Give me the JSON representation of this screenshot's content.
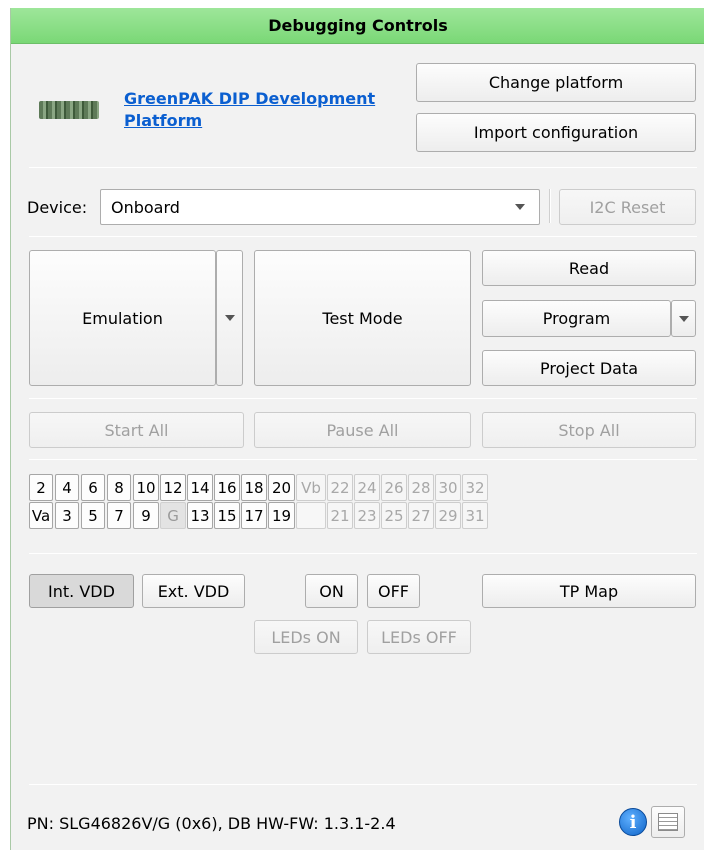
{
  "title": "Debugging Controls",
  "platform": {
    "name": "GreenPAK DIP Development Platform",
    "change_label": "Change platform",
    "import_label": "Import configuration"
  },
  "device": {
    "label": "Device:",
    "value": "Onboard",
    "i2c_reset_label": "I2C Reset"
  },
  "modes": {
    "emulation_label": "Emulation",
    "test_mode_label": "Test Mode",
    "read_label": "Read",
    "program_label": "Program",
    "project_data_label": "Project Data"
  },
  "controls": {
    "start_all": "Start All",
    "pause_all": "Pause All",
    "stop_all": "Stop All"
  },
  "pins": {
    "top_row": [
      "2",
      "4",
      "6",
      "8",
      "10",
      "12",
      "14",
      "16",
      "18",
      "20",
      "Vb",
      "22",
      "24",
      "26",
      "28",
      "30",
      "32"
    ],
    "bottom_row": [
      "Va",
      "3",
      "5",
      "7",
      "9",
      "G",
      "13",
      "15",
      "17",
      "19",
      "",
      "21",
      "23",
      "25",
      "27",
      "29",
      "31"
    ]
  },
  "power": {
    "int_vdd": "Int. VDD",
    "ext_vdd": "Ext. VDD",
    "on": "ON",
    "off": "OFF",
    "tp_map": "TP Map",
    "leds_on": "LEDs ON",
    "leds_off": "LEDs OFF"
  },
  "footer": {
    "status": "PN: SLG46826V/G (0x6), DB HW-FW: 1.3.1-2.4",
    "info_icon": "i"
  },
  "icons": {
    "board": "board-thumbnail-icon",
    "info": "info-icon",
    "log": "log-window-icon"
  },
  "colors": {
    "title_bar": "#7ad876",
    "link": "#0b5fd0",
    "info": "#0f64c8"
  }
}
